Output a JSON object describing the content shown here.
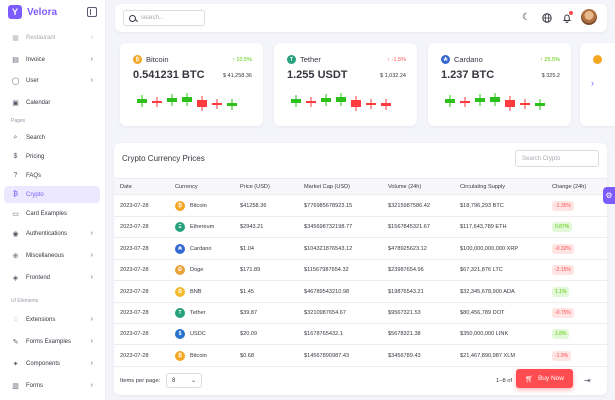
{
  "brand": {
    "name": "Velora",
    "logo_letter": "Y"
  },
  "sidebar": {
    "items": [
      {
        "label": "Restaurant",
        "icon": "building-icon",
        "chevron": true,
        "faded": true
      },
      {
        "label": "Invoice",
        "icon": "document-icon",
        "chevron": true
      },
      {
        "label": "User",
        "icon": "user-icon",
        "chevron": true
      },
      {
        "label": "Calendar",
        "icon": "calendar-icon",
        "chevron": false
      },
      {
        "label": "Search",
        "icon": "search-icon",
        "chevron": false
      },
      {
        "label": "Pricing",
        "icon": "dollar-icon",
        "chevron": false
      },
      {
        "label": "FAQs",
        "icon": "help-icon",
        "chevron": false
      },
      {
        "label": "Crypto",
        "icon": "bitcoin-icon",
        "chevron": false,
        "active": true
      },
      {
        "label": "Card Examples",
        "icon": "card-icon",
        "chevron": false
      },
      {
        "label": "Authentications",
        "icon": "lock-icon",
        "chevron": true
      },
      {
        "label": "Miscellaneous",
        "icon": "globe-icon",
        "chevron": true
      },
      {
        "label": "Frontend",
        "icon": "grid-icon",
        "chevron": true
      },
      {
        "label": "Extensions",
        "icon": "chat-icon",
        "chevron": true
      },
      {
        "label": "Forms Examples",
        "icon": "pen-icon",
        "chevron": true
      },
      {
        "label": "Components",
        "icon": "puzzle-icon",
        "chevron": true
      },
      {
        "label": "Forms",
        "icon": "form-icon",
        "chevron": true
      }
    ],
    "sections": [
      "Pages",
      "UI Elements"
    ]
  },
  "topbar": {
    "search_placeholder": "search..."
  },
  "coins": [
    {
      "name": "Bitcoin",
      "change": "↑ 10.5%",
      "change_dir": "up",
      "amount": "0.541231 BTC",
      "price": "$ 41,258.36",
      "icon_color": "#f5a623",
      "icon_glyph": "₿"
    },
    {
      "name": "Tether",
      "change": "↑ -1.5%",
      "change_dir": "down",
      "amount": "1.255 USDT",
      "price": "$ 1,032.24",
      "icon_color": "#26a17b",
      "icon_glyph": "T"
    },
    {
      "name": "Cardano",
      "change": "↑ 25.5%",
      "change_dir": "up",
      "amount": "1.237 BTC",
      "price": "$ 325.2",
      "icon_color": "#3468d1",
      "icon_glyph": "₳"
    }
  ],
  "coin_candles": [
    [
      "g",
      "r",
      "g",
      "g",
      "r",
      "r",
      "g"
    ],
    [
      "g",
      "r",
      "g",
      "g",
      "r",
      "r",
      "r"
    ],
    [
      "g",
      "r",
      "g",
      "g",
      "r",
      "r",
      "g"
    ]
  ],
  "table": {
    "title": "Crypto Currency Prices",
    "search_placeholder": "Search Crypto",
    "columns": [
      "Date",
      "Currency",
      "Price (USD)",
      "Market Cap (USD)",
      "Volume (24h)",
      "Circulating Supply",
      "Change (24h)"
    ],
    "rows": [
      {
        "date": "2023-07-28",
        "currency": "Bitcoin",
        "icon_color": "#f5a623",
        "icon_glyph": "₿",
        "price": "$41258.36",
        "market_cap": "$776985678923.15",
        "volume": "$3215987586.42",
        "supply": "$18,796,293 BTC",
        "change": "-1.35%",
        "dir": "neg"
      },
      {
        "date": "2023-07-28",
        "currency": "Ethereum",
        "icon_color": "#26a17b",
        "icon_glyph": "Ξ",
        "price": "$2943.21",
        "market_cap": "$345698732198.77",
        "volume": "$1567845321.67",
        "supply": "$117,643,789 ETH",
        "change": "0.87%",
        "dir": "pos"
      },
      {
        "date": "2023-07-28",
        "currency": "Cardano",
        "icon_color": "#3468d1",
        "icon_glyph": "₳",
        "price": "$1.04",
        "market_cap": "$104321876543.12",
        "volume": "$478925623.12",
        "supply": "$100,000,000,000 XRP",
        "change": "-0.32%",
        "dir": "neg"
      },
      {
        "date": "2023-07-28",
        "currency": "Doge",
        "icon_color": "#e8a33a",
        "icon_glyph": "Ð",
        "price": "$171.89",
        "market_cap": "$11567987654.32",
        "volume": "$23987654.96",
        "supply": "$67,321,876 LTC",
        "change": "-2.15%",
        "dir": "neg"
      },
      {
        "date": "2023-07-28",
        "currency": "BNB",
        "icon_color": "#f3ba2f",
        "icon_glyph": "B",
        "price": "$1.45",
        "market_cap": "$46789543210.98",
        "volume": "$19876543.21",
        "supply": "$32,345,678,900 ADA",
        "change": "1.1%",
        "dir": "pos"
      },
      {
        "date": "2023-07-28",
        "currency": "Tether",
        "icon_color": "#26a17b",
        "icon_glyph": "T",
        "price": "$39.87",
        "market_cap": "$3210987654.67",
        "volume": "$9567321.53",
        "supply": "$80,456,789 DOT",
        "change": "-0.75%",
        "dir": "neg"
      },
      {
        "date": "2023-07-28",
        "currency": "USDC",
        "icon_color": "#2775ca",
        "icon_glyph": "$",
        "price": "$20.09",
        "market_cap": "$1678765432.1",
        "volume": "$5678321.38",
        "supply": "$350,000,000 LINK",
        "change": "1.8%",
        "dir": "pos"
      },
      {
        "date": "2023-07-28",
        "currency": "Bitcoin",
        "icon_color": "#f5a623",
        "icon_glyph": "₿",
        "price": "$0.68",
        "market_cap": "$14567890987.43",
        "volume": "$3456789.43",
        "supply": "$21,467,890,987 XLM",
        "change": "-1.9%",
        "dir": "neg"
      }
    ],
    "items_per_page_label": "Items per page:",
    "items_per_page": "8",
    "range": "1–8 of",
    "last_page_glyph": "⇥"
  },
  "buy_button": "Buy Now",
  "colors": {
    "primary": "#7c5cfc",
    "success": "#56ca00",
    "danger": "#ff4c51"
  }
}
